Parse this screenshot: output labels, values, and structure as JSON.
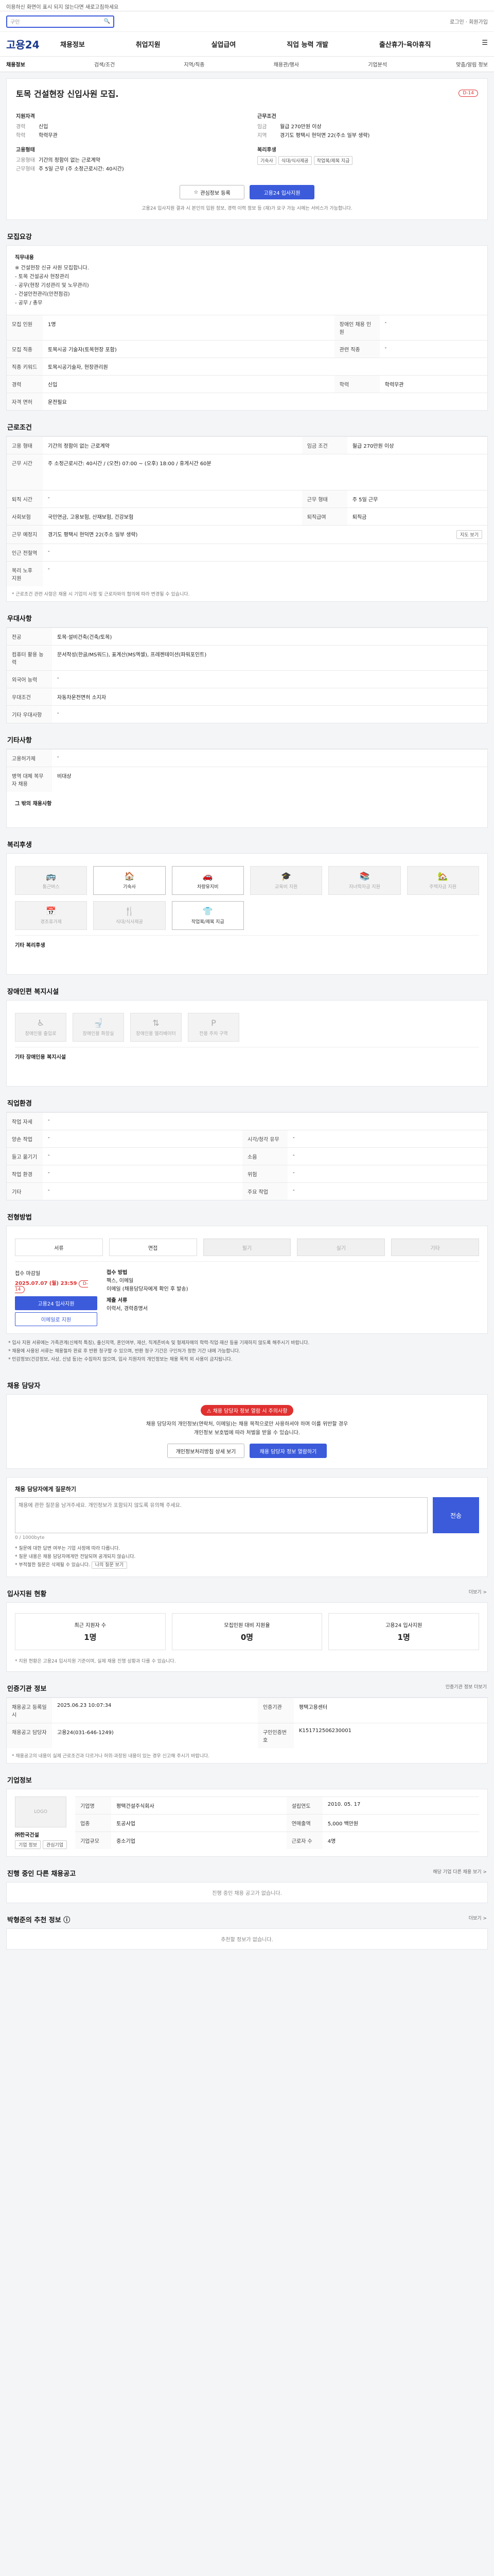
{
  "top_notice": "이용하신 화면이 표시 되지 않는다면 새로고침하세요",
  "search": {
    "placeholder": "구인",
    "top_right": "로그인 · 회원가입"
  },
  "brand": {
    "logo": "고용24"
  },
  "gnb": [
    "채용정보",
    "취업지원",
    "실업급여",
    "직업 능력 개발",
    "출산휴가·육아휴직"
  ],
  "subnav": [
    "채용정보",
    "검색/조건",
    "지역/직종",
    "채용관/행사",
    "기업분석",
    "맞춤/알림 정보"
  ],
  "job": {
    "title": "토목 건설현장 신입사원 모집.",
    "badge": "D-14",
    "labels": {
      "qual": "지원자격",
      "cond": "근무조건",
      "company": "고용형태",
      "welfare": "복리후생"
    },
    "qual": [
      {
        "k": "경력",
        "v": "신입"
      },
      {
        "k": "학력",
        "v": "학력무관"
      }
    ],
    "company": [
      {
        "k": "고용형태",
        "v": "기간의 정함이 없는 근로계약"
      },
      {
        "k": "근무형태",
        "v": "주 5일 근무 (주 소정근로시간: 40시간)"
      }
    ],
    "cond": [
      {
        "k": "임금",
        "v": "월급 270만원 이상"
      },
      {
        "k": "지역",
        "v": "경기도 평택시 현덕면 22(주소 일부 생략)"
      }
    ],
    "welfare": [
      "기숙사",
      "식대/식사제공",
      "작업복/제복 지급"
    ],
    "btn_scrap": "관심정보 등록",
    "btn_apply": "고용24 입사지원",
    "note": "고용24 입사지원 결과 시 본인의 입원 정보, 경력 이력 정보 등 (재)가 요구 가능 시에는 서비스가 가능합니다."
  },
  "sections": {
    "recruit": "모집요강",
    "conditions": "근로조건",
    "apply_hint": "우대사항",
    "etc": "기타사항",
    "welfare": "복리후생",
    "disabled": "장애인편 복지시설",
    "company_info": "직업환경",
    "process": "전형방법",
    "contact": "채용 담당자",
    "status": "입사지원 현황",
    "agency": "인증기관 정보",
    "corp": "기업정보",
    "similar": "진행 중인 다른 채용공고",
    "recommend": "박형준의 추천 정보"
  },
  "recruit": {
    "desc_title": "직무내용",
    "desc_lines": [
      "※ 건설현장 신규 사원 모집합니다.",
      "- 토목 건설공사 현장관리",
      "- 공무(현장 기성관리 및 노무관리)",
      "- 건설안전관리(안전점검)",
      "- 공무 / 총무"
    ],
    "rows": [
      {
        "k": "모집 인원",
        "v": "1명",
        "k2": "장애인 채용 인원",
        "v2": "-"
      },
      {
        "k": "모집 직종",
        "v": "토목시공 기술자(토목현장 포함)",
        "k2": "관련 직종",
        "v2": "-"
      },
      {
        "k": "직종 키워드",
        "v": "토목시공기술자, 현장관리원",
        "k2": "",
        "v2": ""
      },
      {
        "k": "경력",
        "v": "신입",
        "k2": "학력",
        "v2": "학력무관"
      },
      {
        "k": "자격 면허",
        "v": "운전필요",
        "k2": "",
        "v2": ""
      }
    ]
  },
  "conditions": {
    "rows": [
      {
        "k": "고용 형태",
        "v": "기간의 정함이 없는 근로계약",
        "k2": "임금 조건",
        "v2": "월급 270만원 이상"
      },
      {
        "k": "근무 시간",
        "v": "주 소정근로시간: 40시간 / (오전) 07:00 ~ (오후) 18:00 / 휴게시간 60분"
      },
      {
        "k": "퇴직 시간",
        "v": "-",
        "k2": "근무 형태",
        "v2": "주 5일 근무"
      },
      {
        "k": "사회보험",
        "v": "국민연금, 고용보험, 산재보험, 건강보험",
        "k2": "퇴직급여",
        "v2": "퇴직금"
      },
      {
        "k": "근무 예정지",
        "v": "경기도 평택시 현덕면 22(주소 일부 생략)"
      },
      {
        "k": "인근 전철역",
        "v": "-"
      },
      {
        "k": "복리 노후 지원",
        "v": "-"
      }
    ],
    "map_btn": "지도 보기",
    "note": "* 근로조건 관련 사항은 채용 시 기업의 사정 및 근로자와의 협의에 따라 변경될 수 있습니다."
  },
  "pref": {
    "rows": [
      {
        "k": "전공",
        "v": "토목·설비건축(건축/토목)"
      },
      {
        "k": "컴퓨터 활용 능력",
        "v": "문서작성(한글/MS워드), 표계산(MS엑셀), 프레젠테이션(파워포인트)"
      },
      {
        "k": "외국어 능력",
        "v": "-"
      },
      {
        "k": "우대조건",
        "v": "자동차운전면허 소지자"
      },
      {
        "k": "기타 우대사항",
        "v": "-"
      }
    ]
  },
  "etc": {
    "rows": [
      {
        "k": "고용허가제",
        "v": "-"
      },
      {
        "k": "병역 대체 복무자 채용",
        "v": "비대상"
      }
    ],
    "extra_label": "그 밖의 채용사항"
  },
  "welfare_icons": [
    {
      "name": "통근버스",
      "on": false
    },
    {
      "name": "기숙사",
      "on": true
    },
    {
      "name": "차량유지비",
      "on": true
    },
    {
      "name": "교육비 지원",
      "on": false
    },
    {
      "name": "자녀학자금 지원",
      "on": false
    },
    {
      "name": "주택자금 지원",
      "on": false
    },
    {
      "name": "경조휴가제",
      "on": false
    },
    {
      "name": "식대/식사제공",
      "on": false
    },
    {
      "name": "작업복/제복 지급",
      "on": true
    }
  ],
  "welfare_extra": "기타 복리후생",
  "disabled_icons": [
    "장애인용 출입로",
    "장애인용 화장실",
    "장애인용 엘리베이터",
    "전용 주차 구역"
  ],
  "disabled_extra": "기타 장애인용 복지시설",
  "env": {
    "rows": [
      {
        "k": "작업 자세",
        "v": "-"
      },
      {
        "k": "양손 작업",
        "v": "-",
        "k2": "시각/청각 유무",
        "v2": "-"
      },
      {
        "k": "들고 옮기기",
        "v": "-",
        "k2": "소음",
        "v2": "-"
      },
      {
        "k": "작업 환경",
        "v": "-",
        "k2": "위험",
        "v2": "-"
      },
      {
        "k": "기타",
        "v": "-",
        "k2": "주요 작업",
        "v2": "-"
      }
    ]
  },
  "process": {
    "steps": [
      {
        "label": "서류",
        "on": true
      },
      {
        "label": "면접",
        "on": true
      },
      {
        "label": "필기",
        "on": false
      },
      {
        "label": "실기",
        "on": false
      },
      {
        "label": "기타",
        "on": false
      }
    ],
    "apply_title": "접수 마감일",
    "apply_date": "2025.07.07 (월) 23:59",
    "apply_dday": "D-14",
    "btn_apply": "고용24 입사지원",
    "btn_email": "이메일로 지원",
    "method_title": "접수 방법",
    "methods": [
      "팩스, 이메일",
      "이메일 (채용담당자에게 확인 후 발송)",
      "제출 서류",
      "이력서, 경력증명서"
    ],
    "bullets": [
      "* 입사 지원 서류에는 가족관계(신체적 특징), 출신지역, 혼인여부, 재산, 직계존비속 및 형제자매의 학력·직업·재산 등을 기재하지 않도록 해주시기 바랍니다.",
      "* 채용에 사용된 서류는 채용절차 완료 후 반환 청구할 수 있으며, 반환 청구 기간은 구인처가 정한 기간 내에 가능합니다.",
      "* 민감정보(건강정보, 사상, 신념 등)는 수집하지 않으며, 입사 지원자의 개인정보는 채용 목적 외 사용이 금지됩니다."
    ]
  },
  "contact": {
    "warn": "채용 담당자 정보 열람 시 주의사항",
    "lines": [
      "채용 담당자의 개인정보(연락처, 이메일)는 채용 목적으로만 사용하셔야 하며 이를 위반할 경우",
      "개인정보 보호법에 따라 처벌을 받을 수 있습니다."
    ],
    "btn_view": "개인정보처리방침 상세 보기",
    "btn_show": "채용 담당자 정보 열람하기"
  },
  "qa": {
    "title": "채용 담당자에게 질문하기",
    "placeholder": "채용에 관한 질문을 남겨주세요. 개인정보가 포함되지 않도록 유의해 주세요.",
    "counter": "0 / 1000byte",
    "send": "전송",
    "notes": [
      "* 질문에 대한 답변 여부는 기업 사정에 따라 다릅니다.",
      "* 질문 내용은 채용 담당자에게만 전달되며 공개되지 않습니다.",
      "* 부적절한 질문은 삭제될 수 있습니다."
    ],
    "small_btn": "나의 질문 보기"
  },
  "status": {
    "boxes": [
      {
        "label": "최근 지원자 수",
        "num": "1명"
      },
      {
        "label": "모집인원 대비 지원율",
        "num": "0명"
      },
      {
        "label": "고용24 입사지원",
        "num": "1명"
      }
    ],
    "note": "* 지원 현황은 고용24 입사지원 기준이며, 실제 채용 진행 상황과 다를 수 있습니다.",
    "more": "더보기 >"
  },
  "agency": {
    "more": "인증기관 정보 더보기",
    "rows": [
      {
        "k": "채용공고 등록일시",
        "v": "2025.06.23 10:07:34",
        "k2": "인증기관",
        "v2": "평택고용센터"
      },
      {
        "k": "채용공고 담당자",
        "v": "고용24(031-646-1249)",
        "k2": "구인인증번호",
        "v2": "K151712506230001"
      }
    ],
    "note": "* 채용공고의 내용이 실제 근로조건과 다르거나 허위·과장된 내용이 있는 경우 신고해 주시기 바랍니다."
  },
  "corp": {
    "logo": "LOGO",
    "name": "㈜한국건설",
    "btn1": "기업 정보",
    "btn2": "관심기업",
    "rows": [
      {
        "k": "기업명",
        "v": "평택건설주식회사",
        "k2": "설립연도",
        "v2": "2010. 05. 17"
      },
      {
        "k": "업종",
        "v": "토공사업",
        "k2": "연매출액",
        "v2": "5,000 백만원"
      },
      {
        "k": "기업규모",
        "v": "중소기업",
        "k2": "근로자 수",
        "v2": "4명"
      }
    ]
  },
  "similar": {
    "more": "해당 기업 다른 채용 보기 >",
    "empty": "진행 중인 채용 공고가 없습니다."
  },
  "recommend": {
    "more": "더보기 >",
    "empty": "추천할 정보가 없습니다."
  }
}
